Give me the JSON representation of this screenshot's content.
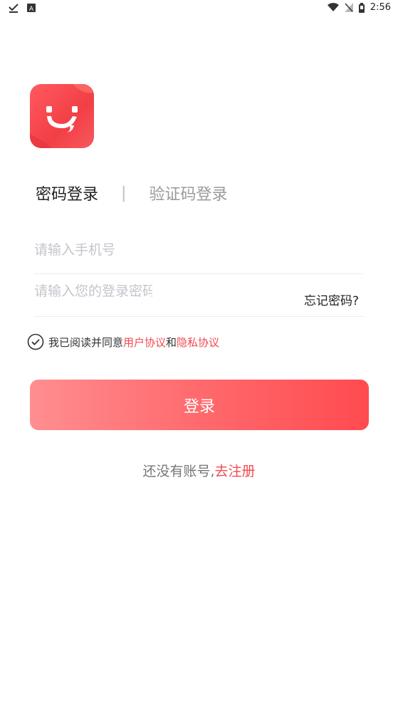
{
  "status_bar": {
    "time": "2:56",
    "left_icons": [
      "check-notification-icon",
      "a-notification-icon"
    ],
    "right_icons": [
      "wifi-icon",
      "signal-off-icon",
      "battery-icon"
    ]
  },
  "logo": {
    "icon": "smile-logo-icon",
    "color": "#f23f46"
  },
  "tabs": {
    "password_login": "密码登录",
    "divider": "|",
    "code_login": "验证码登录"
  },
  "form": {
    "phone_placeholder": "请输入手机号",
    "phone_value": "",
    "password_placeholder": "请输入您的登录密码",
    "password_value": "",
    "forgot_password": "忘记密码?"
  },
  "agreement": {
    "prefix": "我已阅读并同意",
    "user_agreement": "用户协议",
    "and": "和",
    "privacy_agreement": "隐私协议",
    "checked": true
  },
  "login_button": "登录",
  "register": {
    "prompt": "还没有账号,",
    "link": "去注册"
  },
  "colors": {
    "accent": "#f04a4f",
    "button_start": "#ff8e90",
    "button_end": "#ff4b50"
  }
}
